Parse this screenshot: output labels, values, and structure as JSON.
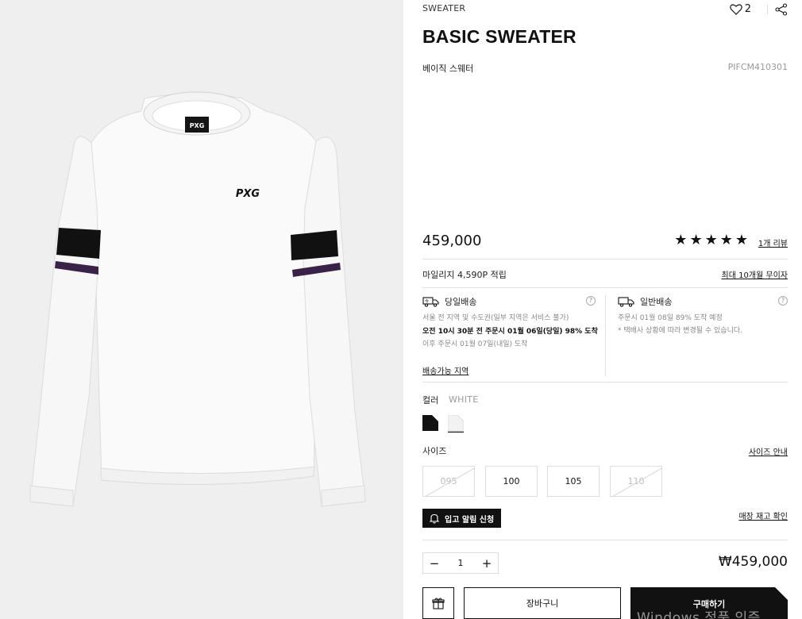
{
  "product": {
    "category": "SWEATER",
    "title": "BASIC SWEATER",
    "subname": "베이직 스웨터",
    "code": "PIFCM410301",
    "wish_count": "2",
    "price": "459,000",
    "rating_stars": 5,
    "review_link": "1개 리뷰"
  },
  "benefits": {
    "mileage": "마일리지 4,590P 적립",
    "installment": "최대 10개월 무이자"
  },
  "shipping": {
    "same_day": {
      "title": "당일배송",
      "line1": "서울 전 지역 및 수도권(일부 지역은 서비스 불가)",
      "line2": "오전 10시 30분 전 주문시 01월 06일(당일) 98% 도착",
      "line3": "이후 주문시 01월 07일(내일) 도착"
    },
    "standard": {
      "title": "일반배송",
      "line1": "주문시 01월 08일 89% 도착 예정",
      "line2": "* 택배사 상황에 따라 변경될 수 있습니다."
    },
    "area_link": "배송가능 지역"
  },
  "color": {
    "label": "컬러",
    "selected": "WHITE",
    "swatches": [
      {
        "name": "black",
        "hex": "#111111"
      },
      {
        "name": "white",
        "hex": "#f2f2f2"
      }
    ]
  },
  "size": {
    "label": "사이즈",
    "guide_link": "사이즈 안내",
    "options": [
      {
        "label": "095",
        "available": false
      },
      {
        "label": "100",
        "available": true
      },
      {
        "label": "105",
        "available": true
      },
      {
        "label": "110",
        "available": false
      }
    ]
  },
  "restock": {
    "notify_button": "입고 알림 신청",
    "store_stock_link": "매장 재고 확인"
  },
  "order": {
    "quantity": "1",
    "total": "₩459,000",
    "cart_button": "장바구니",
    "buy_button": "구매하기"
  },
  "image": {
    "logo_text": "PXG",
    "collar_label": "PXG"
  },
  "os_watermark": "Windows 정품 인증"
}
